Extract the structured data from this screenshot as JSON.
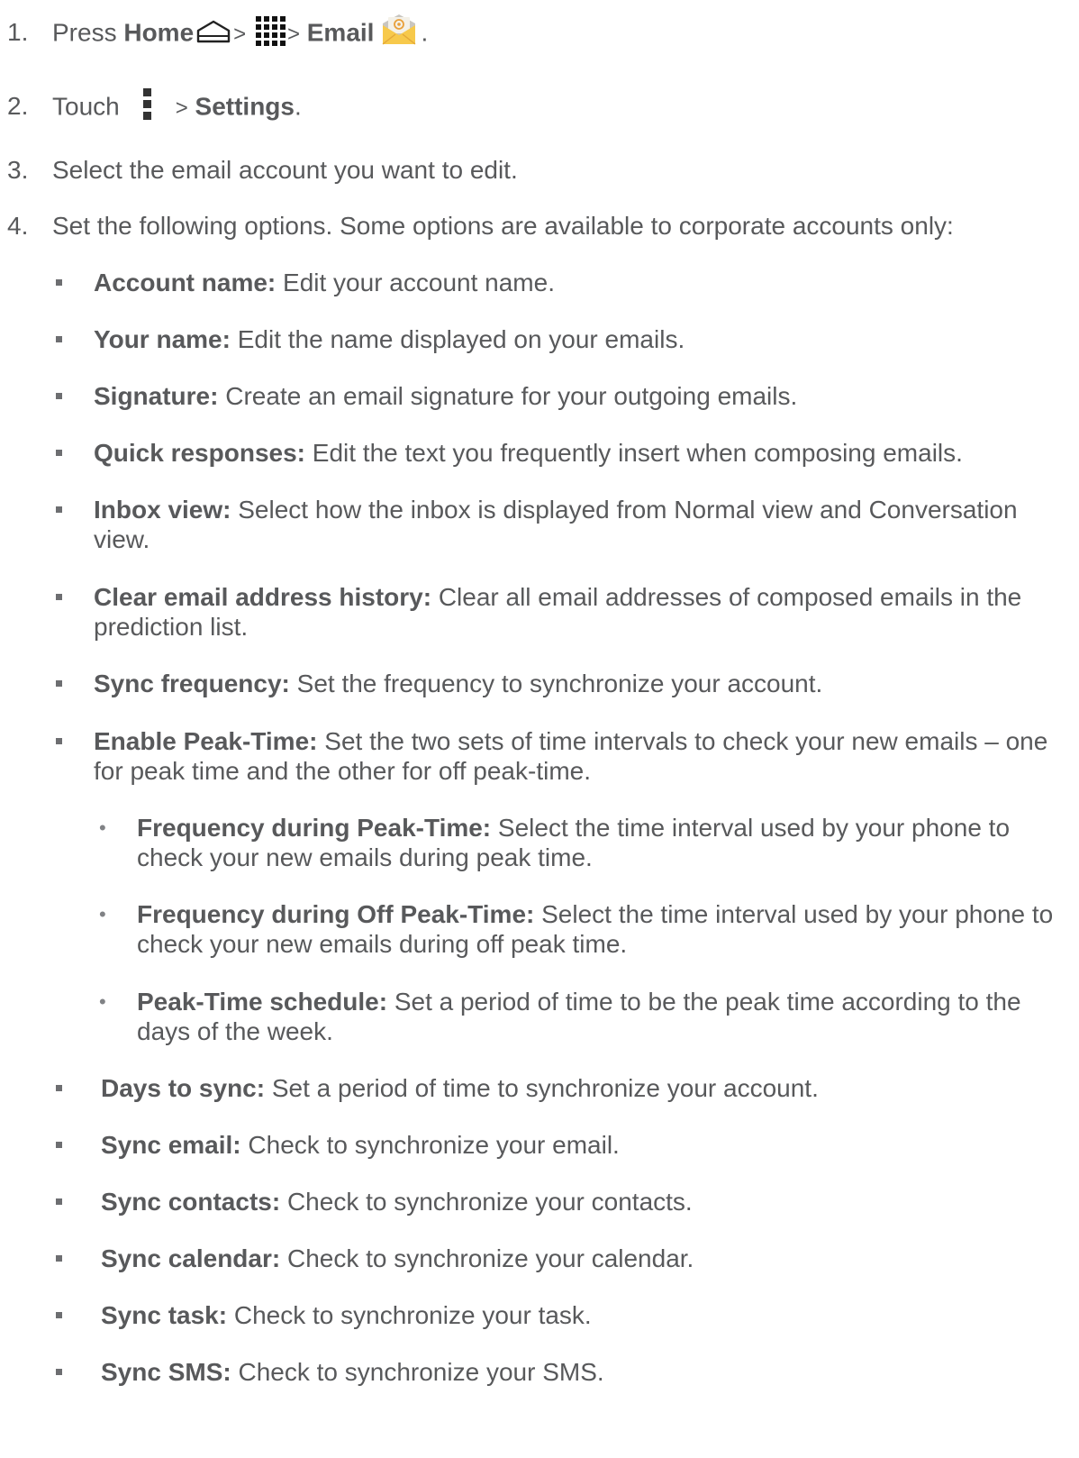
{
  "steps": [
    {
      "number": "1.",
      "press": "Press",
      "home": "Home",
      "sep1": ">",
      "sep2": ">",
      "email": "Email",
      "end": "."
    },
    {
      "number": "2.",
      "touch": "Touch",
      "sep": ">",
      "settings": "Settings",
      "end": "."
    },
    {
      "number": "3.",
      "text": "Select the email account you want to edit."
    },
    {
      "number": "4.",
      "text": "Set the following options. Some options are available to corporate accounts only:"
    }
  ],
  "options": [
    {
      "label": "Account name:",
      "text": " Edit your account name."
    },
    {
      "label": "Your name:",
      "text": " Edit the name displayed on your emails."
    },
    {
      "label": "Signature:",
      "text": " Create an email signature for your outgoing emails."
    },
    {
      "label": "Quick responses:",
      "text": " Edit the text you frequently insert when composing emails."
    },
    {
      "label": "Inbox view:",
      "text": " Select how the inbox is displayed from Normal view and Conversation view."
    },
    {
      "label": "Clear email address history:",
      "text": " Clear all email addresses of composed emails in the prediction list."
    },
    {
      "label": "Sync frequency:",
      "text": " Set the frequency to synchronize your account."
    },
    {
      "label": "Enable Peak-Time:",
      "text": " Set the two sets of time intervals to check your new emails – one for peak time and the other for off peak-time."
    }
  ],
  "sub_options": [
    {
      "label": "Frequency during Peak-Time:",
      "text": " Select the time interval used by your phone to check your new emails during peak time."
    },
    {
      "label": "Frequency during Off Peak-Time:",
      "text": " Select the time interval used by your phone to check your new emails during off peak time."
    },
    {
      "label": "Peak-Time schedule:",
      "text": " Set a period of time to be the peak time according to the days of the week."
    }
  ],
  "sync_options": [
    {
      "label": "Days to sync:",
      "text": " Set a period of time to synchronize your account."
    },
    {
      "label": "Sync email:",
      "text": " Check to synchronize your email."
    },
    {
      "label": "Sync contacts:",
      "text": " Check to synchronize your contacts."
    },
    {
      "label": "Sync calendar:",
      "text": " Check to synchronize your calendar."
    },
    {
      "label": "Sync task:",
      "text": " Check to synchronize your task."
    },
    {
      "label": "Sync SMS:",
      "text": " Check to synchronize your SMS."
    }
  ],
  "colors": {
    "text": "#58595b",
    "email_icon_body": "#f7c94b",
    "email_icon_letter": "#e9a03a"
  },
  "icons": [
    "home-icon",
    "app-grid-icon",
    "email-app-icon",
    "menu-icon"
  ]
}
